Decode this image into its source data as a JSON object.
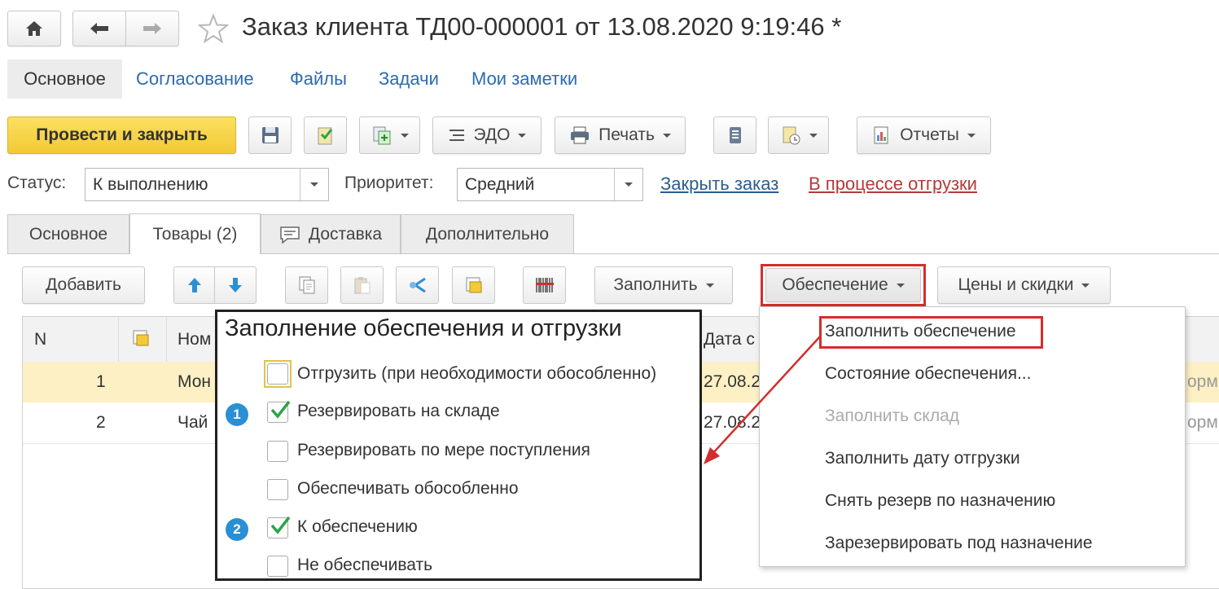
{
  "window": {
    "title": "Заказ клиента ТД00-000001 от 13.08.2020 9:19:46 *"
  },
  "topnav": {
    "items": [
      "Основное",
      "Согласование",
      "Файлы",
      "Задачи",
      "Мои заметки"
    ]
  },
  "toolbar": {
    "post_close": "Провести и закрыть",
    "edo": "ЭДО",
    "print": "Печать",
    "reports": "Отчеты"
  },
  "status": {
    "label": "Статус:",
    "value": "К выполнению",
    "priority_label": "Приоритет:",
    "priority_value": "Средний",
    "close_order": "Закрыть заказ",
    "shipping_state": "В процессе отгрузки"
  },
  "tabs": [
    "Основное",
    "Товары (2)",
    "Доставка",
    "Дополнительно"
  ],
  "goods_toolbar": {
    "add": "Добавить",
    "fill": "Заполнить",
    "supply": "Обеспечение",
    "prices": "Цены и скидки"
  },
  "table": {
    "headers": [
      "N",
      "Ном",
      "Дата с"
    ],
    "rows": [
      {
        "n": "1",
        "name": "Мон",
        "date": "27.08.2",
        "tail": "орм"
      },
      {
        "n": "2",
        "name": "Чай",
        "date": "27.08.2",
        "tail": "орм"
      }
    ]
  },
  "supply_menu": {
    "items": [
      "Заполнить обеспечение",
      "Состояние обеспечения...",
      "Заполнить склад",
      "Заполнить дату отгрузки",
      "Снять резерв по назначению",
      "Зарезервировать под назначение"
    ]
  },
  "fill_panel": {
    "title": "Заполнение обеспечения и отгрузки",
    "options": [
      {
        "label": "Отгрузить (при необходимости обособленно)",
        "checked": false
      },
      {
        "label": "Резервировать на складе",
        "checked": true
      },
      {
        "label": "Резервировать по мере поступления",
        "checked": false
      },
      {
        "label": "Обеспечивать обособленно",
        "checked": false
      },
      {
        "label": "К обеспечению",
        "checked": true
      },
      {
        "label": "Не обеспечивать",
        "checked": false
      }
    ],
    "badges": [
      "1",
      "2"
    ]
  },
  "colors": {
    "primary_button": "#f7d44a",
    "selected_row": "#fdf0c4",
    "highlight_red": "#d42d2d",
    "badge_blue": "#2b8fd4",
    "check_green": "#2aa548"
  }
}
